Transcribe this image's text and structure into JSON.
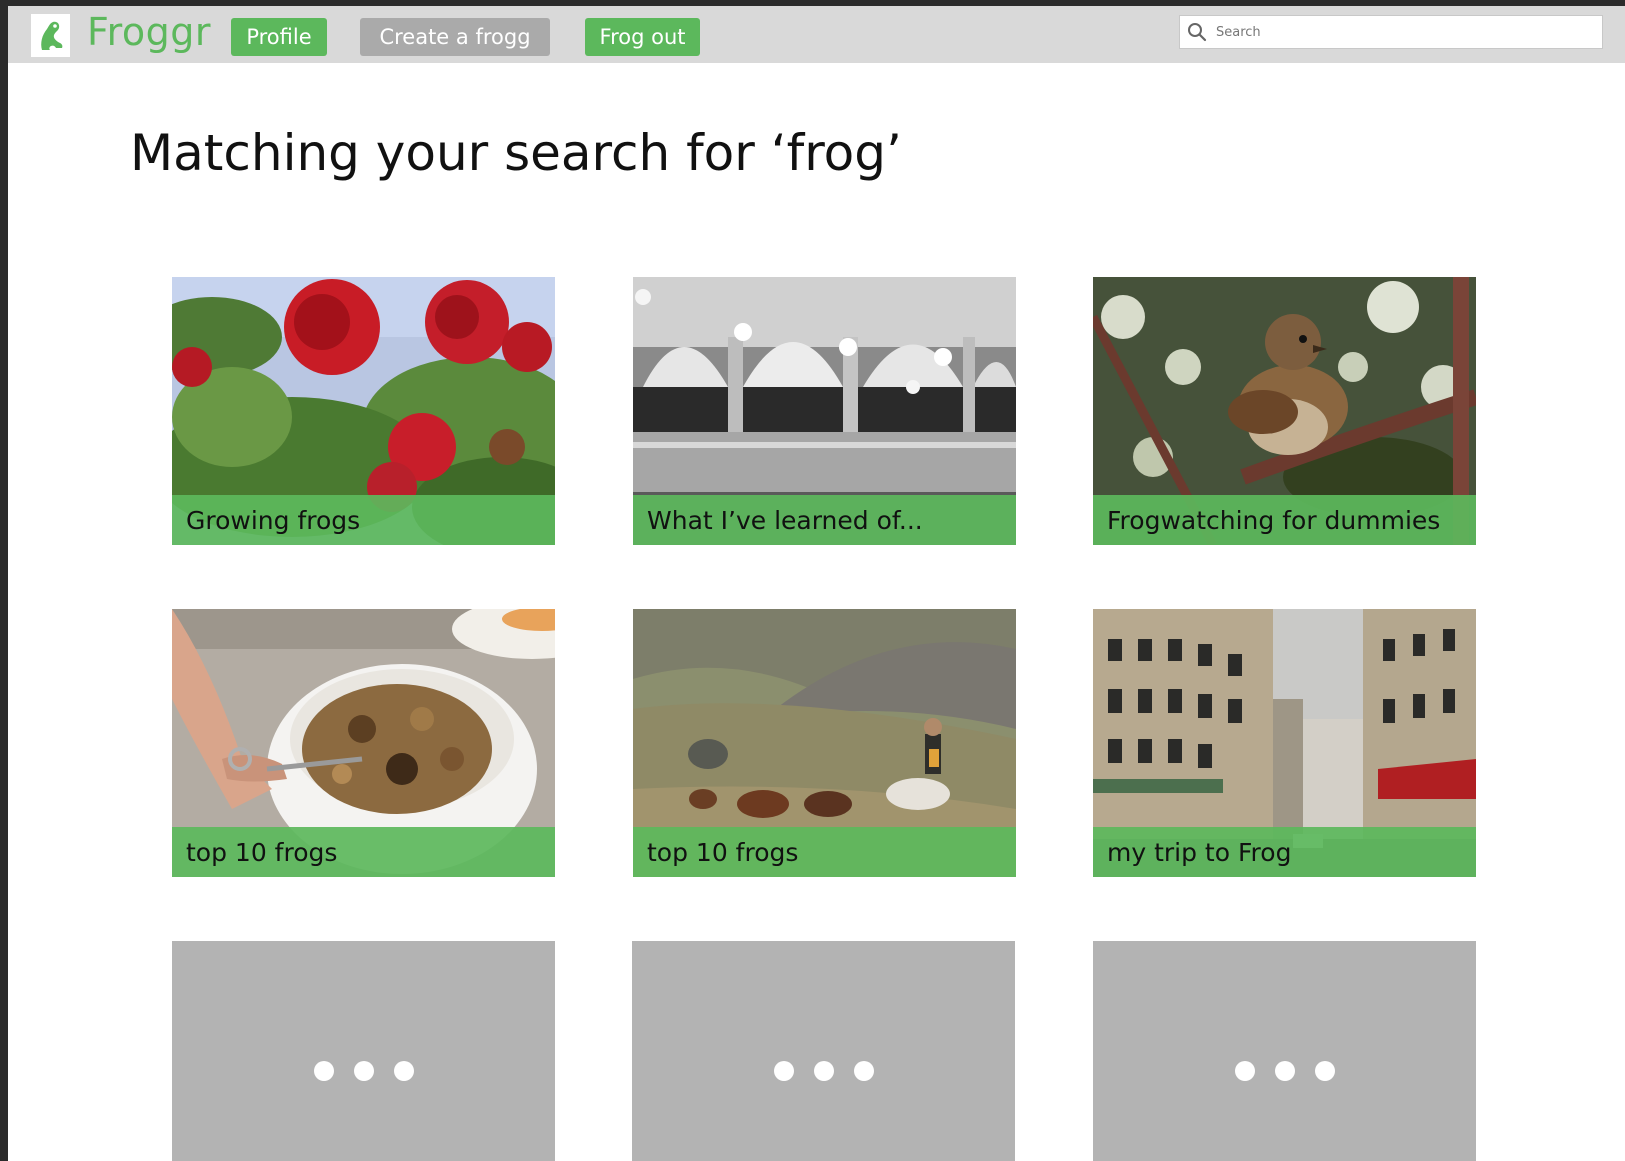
{
  "app": {
    "brand": "Froggr",
    "logo_icon": "frog-logo-icon"
  },
  "nav": {
    "profile": "Profile",
    "create": "Create a frogg",
    "logout": "Frog out"
  },
  "search": {
    "placeholder": "Search",
    "value": ""
  },
  "page": {
    "heading": "Matching your search for ‘frog’"
  },
  "results": [
    {
      "title": "Growing frogs",
      "image": "red roses against blue sky"
    },
    {
      "title": "What I’ve learned of...",
      "image": "black and white ornate hall with balconies"
    },
    {
      "title": "Frogwatching for dummies",
      "image": "sparrow perched on branch"
    },
    {
      "title": "top 10 frogs",
      "image": "hand holding spoon over granola bowl"
    },
    {
      "title": "top 10 frogs",
      "image": "horses galloping in mountain valley"
    },
    {
      "title": "my trip to Frog",
      "image": "city street with classic buildings"
    }
  ],
  "placeholders": [
    "loading",
    "loading",
    "loading"
  ],
  "colors": {
    "accent": "#5cb85c",
    "topbar": "#d9d9d9",
    "disabled_button": "#aaaaaa",
    "placeholder": "#b3b3b3"
  }
}
